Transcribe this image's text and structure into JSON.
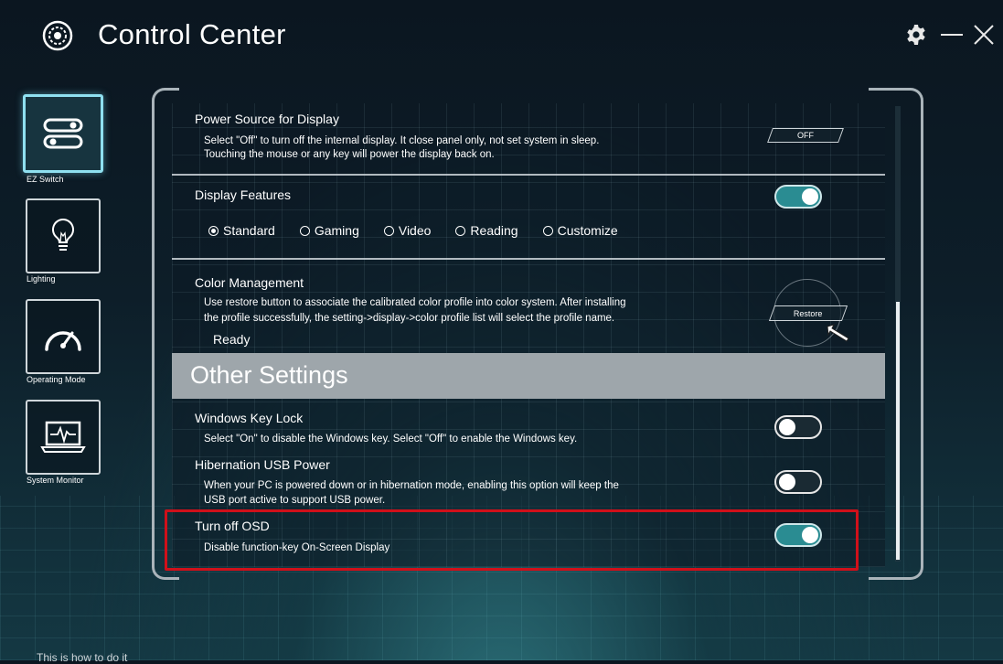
{
  "app": {
    "title": "Control Center"
  },
  "window_controls": [
    "gear-icon",
    "minimize-icon",
    "close-icon"
  ],
  "nav": [
    {
      "label": "EZ Switch",
      "icon": "ez-switch-icon",
      "active": true
    },
    {
      "label": "Lighting",
      "icon": "lightbulb-icon",
      "active": false
    },
    {
      "label": "Operating Mode",
      "icon": "gauge-icon",
      "active": false
    },
    {
      "label": "System Monitor",
      "icon": "monitor-icon",
      "active": false
    }
  ],
  "settings": {
    "power_source": {
      "title": "Power Source for Display",
      "desc1": "Select \"Off\" to turn off the internal display. It close panel only, not set system in sleep.",
      "desc2": "Touching the mouse or any key will power the display back on.",
      "button": "OFF"
    },
    "display_features": {
      "title": "Display Features",
      "toggle": "on",
      "options": [
        "Standard",
        "Gaming",
        "Video",
        "Reading",
        "Customize"
      ],
      "selected": "Standard"
    },
    "color_management": {
      "title": "Color Management",
      "desc1": "Use restore button to associate the calibrated color profile into color system. After installing",
      "desc2": "the profile successfully, the setting->display->color profile list will select the profile name.",
      "button": "Restore",
      "status": "Ready"
    }
  },
  "other_settings": {
    "header": "Other Settings",
    "windows_key_lock": {
      "title": "Windows Key Lock",
      "desc": "Select \"On\" to disable the Windows key. Select \"Off\" to enable the Windows key.",
      "toggle": "off"
    },
    "hibernation_usb": {
      "title": "Hibernation USB Power",
      "desc1": "When your PC is powered down or in hibernation mode, enabling this option will keep the",
      "desc2": "USB port active to support USB power.",
      "toggle": "off"
    },
    "turn_off_osd": {
      "title": "Turn off OSD",
      "desc": "Disable function-key On-Screen Display",
      "toggle": "on"
    }
  },
  "colors": {
    "accent": "#2a8c92",
    "highlight": "#d0101a",
    "active_nav": "#8fe0f0"
  },
  "under_text": "This is how to do it"
}
